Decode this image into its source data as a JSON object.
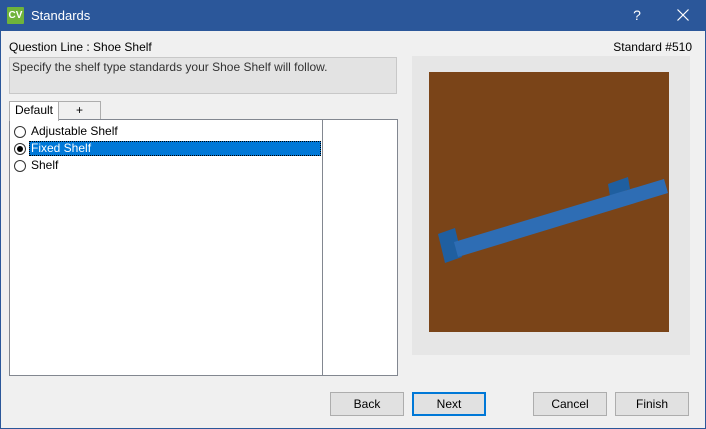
{
  "window": {
    "logo": "CV",
    "title": "Standards",
    "help_label": "?",
    "icons": {
      "close": "close-icon"
    },
    "accent": "#2b579a"
  },
  "header": {
    "question_line": "Question Line : Shoe Shelf",
    "standard_number": "Standard #510",
    "instructions": "Specify the shelf type standards your Shoe Shelf will follow."
  },
  "tabs": [
    {
      "label": "Default",
      "active": true
    },
    {
      "label": "+",
      "active": false
    }
  ],
  "options": [
    {
      "label": "Adjustable Shelf",
      "checked": false
    },
    {
      "label": "Fixed Shelf",
      "checked": true
    },
    {
      "label": "Shelf",
      "checked": false
    }
  ],
  "preview": {
    "background": "#e6e6e6",
    "panel_color": "#7a4418",
    "shelf_color": "#2e6db4"
  },
  "buttons": {
    "back": "Back",
    "next": "Next",
    "cancel": "Cancel",
    "finish": "Finish"
  }
}
